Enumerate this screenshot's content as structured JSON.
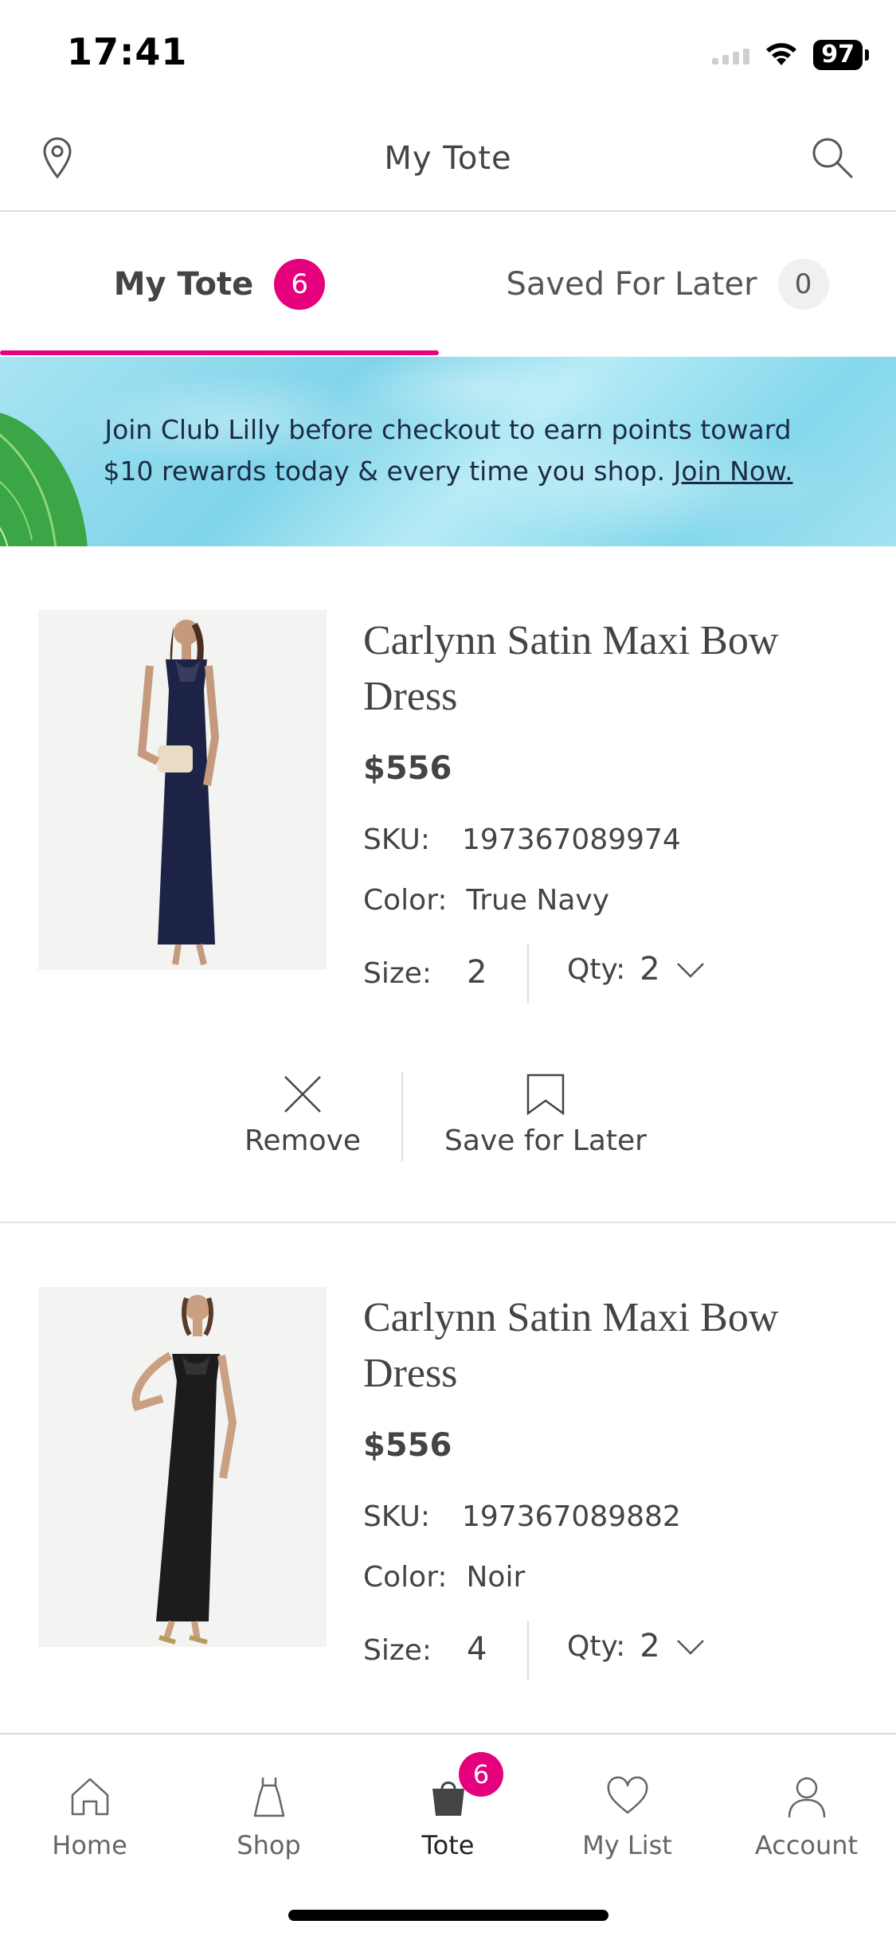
{
  "status_bar": {
    "time": "17:41",
    "battery": "97"
  },
  "header": {
    "title": "My Tote"
  },
  "tabs": [
    {
      "label": "My Tote",
      "badge": "6",
      "active": true
    },
    {
      "label": "Saved For Later",
      "badge": "0",
      "active": false
    }
  ],
  "promo": {
    "line1": "Join Club Lilly before checkout to earn points toward",
    "line2": "$10 rewards today & every time you shop.",
    "link": "Join Now."
  },
  "products": [
    {
      "name": "Carlynn Satin Maxi Bow Dress",
      "price": "$556",
      "sku_label": "SKU:",
      "sku": "197367089974",
      "color_label": "Color:",
      "color": "True Navy",
      "size_label": "Size:",
      "size": "2",
      "qty_label": "Qty:",
      "qty": "2",
      "dress_color": "#1d2347"
    },
    {
      "name": "Carlynn Satin Maxi Bow Dress",
      "price": "$556",
      "sku_label": "SKU:",
      "sku": "197367089882",
      "color_label": "Color:",
      "color": "Noir",
      "size_label": "Size:",
      "size": "4",
      "qty_label": "Qty:",
      "qty": "2",
      "dress_color": "#1c1c1e"
    }
  ],
  "actions": {
    "remove": "Remove",
    "save_for_later": "Save for Later"
  },
  "bottom_nav": [
    {
      "label": "Home",
      "icon": "home-icon"
    },
    {
      "label": "Shop",
      "icon": "dress-icon"
    },
    {
      "label": "Tote",
      "icon": "bag-icon",
      "badge": "6",
      "active": true
    },
    {
      "label": "My List",
      "icon": "heart-icon"
    },
    {
      "label": "Account",
      "icon": "person-icon"
    }
  ],
  "colors": {
    "accent": "#e5007e",
    "text": "#444444",
    "divider": "#dcdcdc"
  }
}
